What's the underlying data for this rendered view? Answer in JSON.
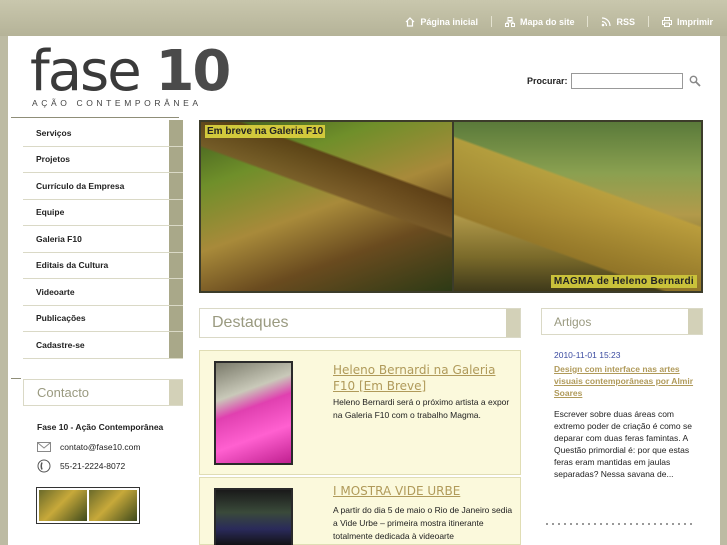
{
  "toplinks": {
    "home": "Página inicial",
    "sitemap": "Mapa do site",
    "rss": "RSS",
    "print": "Imprimir"
  },
  "logo": {
    "main_light": "fase ",
    "main_bold": "10",
    "subtitle": "AÇÃO CONTEMPORÂNEA"
  },
  "search": {
    "label": "Procurar:",
    "value": ""
  },
  "nav": {
    "items": [
      "Serviços",
      "Projetos",
      "Currículo da Empresa",
      "Equipe",
      "Galeria F10",
      "Editais da Cultura",
      "Videoarte",
      "Publicações",
      "Cadastre-se"
    ]
  },
  "contact": {
    "title": "Contacto",
    "name": "Fase 10 - Ação Contemporânea",
    "email": "contato@fase10.com",
    "phone": "55-21-2224-8072"
  },
  "banner": {
    "caption_left": "Em breve na Galeria F10",
    "caption_right": "MAGMA de Heleno Bernardi"
  },
  "destaques": {
    "title": "Destaques",
    "cards": [
      {
        "title": "Heleno Bernardi na Galeria F10 [Em Breve]",
        "body": "Heleno Bernardi será o próximo artista a expor na Galeria F10 com o trabalho Magma."
      },
      {
        "title": "I MOSTRA VIDE URBE",
        "body": "A partir do dia 5 de maio o Rio de Janeiro sedia a Vide Urbe – primeira mostra itinerante totalmente dedicada à videoarte"
      }
    ]
  },
  "artigos": {
    "title": "Artigos",
    "date": "2010-11-01 15:23",
    "headline": "Design com interface nas artes visuais contemporâneas por Almir Soares",
    "body": "Escrever sobre duas áreas com extremo poder de criação é como se deparar com duas feras famintas. A Questão primordial é: por que estas feras eram mantidas em jaulas separadas? Nessa savana de..."
  },
  "colors": {
    "background": "#bdbba3",
    "accent_tab": "#a9a889",
    "link": "#b09a5a",
    "date": "#3a4aa0",
    "card_bg": "#fbf9dc"
  }
}
